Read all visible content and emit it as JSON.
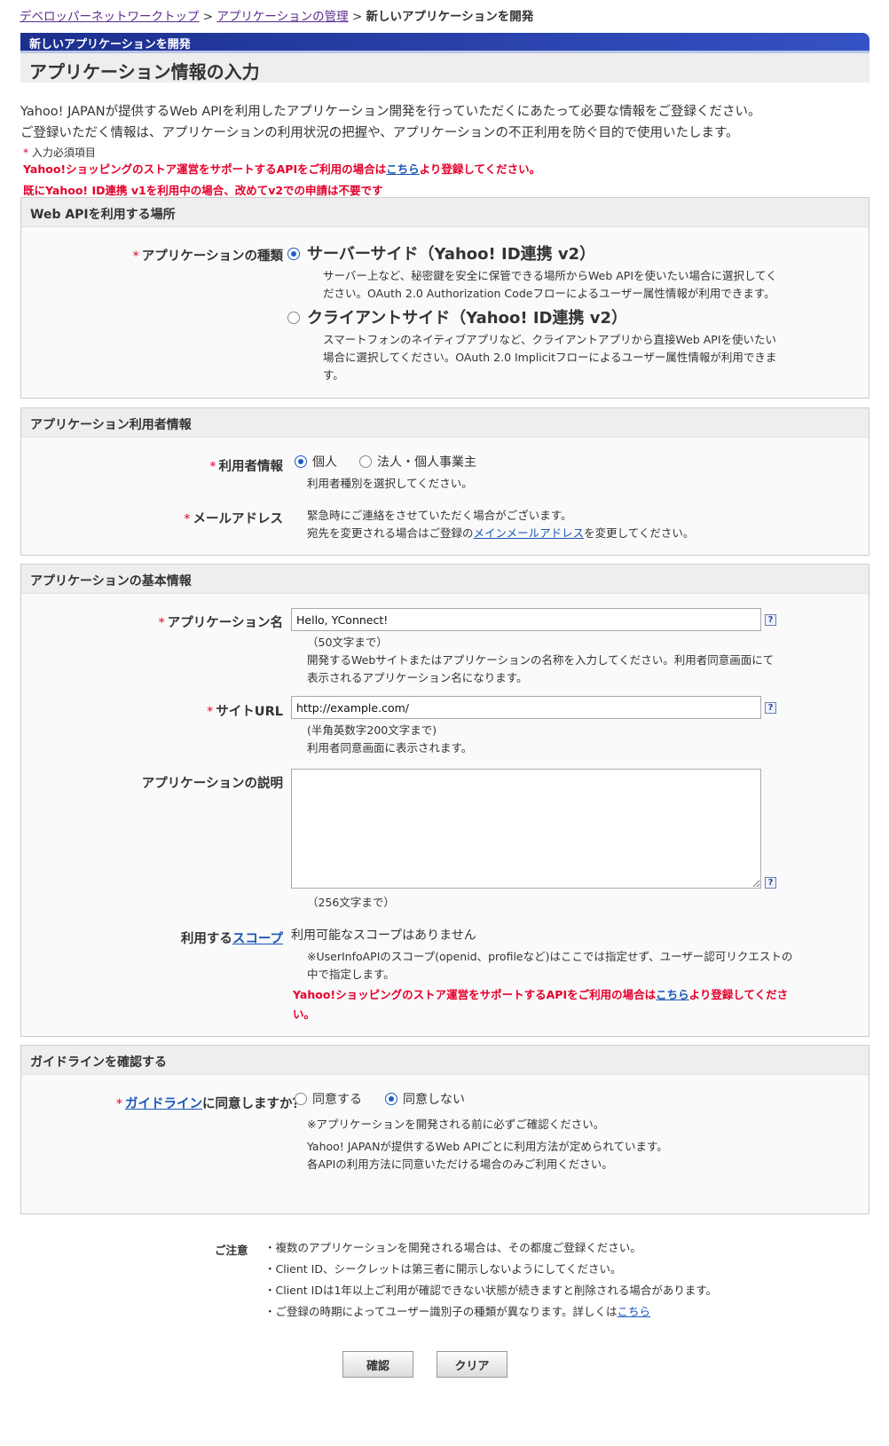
{
  "breadcrumb": {
    "items": [
      "デベロッパーネットワークトップ",
      "アプリケーションの管理"
    ],
    "separator": ">",
    "current": "新しいアプリケーションを開発"
  },
  "banner": {
    "subtitle": "新しいアプリケーションを開発",
    "title": "アプリケーション情報の入力"
  },
  "intro": {
    "line1": "Yahoo! JAPANが提供するWeb APIを利用したアプリケーション開発を行っていただくにあたって必要な情報をご登録ください。",
    "line2": "ご登録いただく情報は、アプリケーションの利用状況の把握や、アプリケーションの不正利用を防ぐ目的で使用いたします。",
    "required_note": "入力必須項目",
    "required_mark": "*",
    "shopping_pre": "Yahoo!ショッピングのストア運営をサポートするAPIをご利用の場合は",
    "shopping_link": "こちら",
    "shopping_post": "より登録してください。",
    "v1_note": "既にYahoo! ID連携 v1を利用中の場合、改めてv2での申請は不要です"
  },
  "section_webapi": {
    "header": "Web APIを利用する場所",
    "label": "アプリケーションの種類",
    "option_server": "サーバーサイド（Yahoo! ID連携 v2）",
    "option_server_desc1": "サーバー上など、秘密鍵を安全に保管できる場所からWeb APIを使いたい場合に選択してく",
    "option_server_desc2": "ださい。OAuth 2.0 Authorization Codeフローによるユーザー属性情報が利用できます。",
    "option_client": "クライアントサイド（Yahoo! ID連携 v2）",
    "option_client_desc1": "スマートフォンのネイティブアプリなど、クライアントアプリから直接Web APIを使いたい",
    "option_client_desc2": "場合に選択してください。OAuth 2.0 Implicitフローによるユーザー属性情報が利用できま",
    "option_client_desc3": "す。"
  },
  "section_user": {
    "header": "アプリケーション利用者情報",
    "user_label": "利用者情報",
    "opt_individual": "個人",
    "opt_corp": "法人・個人事業主",
    "user_hint": "利用者種別を選択してください。",
    "mail_label": "メールアドレス",
    "mail_text1": "緊急時にご連絡をさせていただく場合がございます。",
    "mail_text2_pre": "宛先を変更される場合はご登録の",
    "mail_link": "メインメールアドレス",
    "mail_text2_post": "を変更してください。"
  },
  "section_basic": {
    "header": "アプリケーションの基本情報",
    "name_label": "アプリケーション名",
    "name_value": "Hello, YConnect!",
    "name_limit": "（50文字まで）",
    "name_desc1": "開発するWebサイトまたはアプリケーションの名称を入力してください。利用者同意画面にて",
    "name_desc2": "表示されるアプリケーション名になります。",
    "url_label": "サイトURL",
    "url_value": "http://example.com/",
    "url_limit": "(半角英数字200文字まで)",
    "url_desc": "利用者同意画面に表示されます。",
    "desc_label": "アプリケーションの説明",
    "desc_value": "",
    "desc_limit": "（256文字まで）",
    "scope_label_pre": "利用する",
    "scope_label_link": "スコープ",
    "scope_none": "利用可能なスコープはありません",
    "scope_note1": "※UserInfoAPIのスコープ(openid、profileなど)はここでは指定せず、ユーザー認可リクエストの",
    "scope_note2": "中で指定します。",
    "scope_red1_pre": "Yahoo!ショッピングのストア運営をサポートするAPIをご利用の場合は",
    "scope_red1_link": "こちら",
    "scope_red1_post": "より登録してくださ",
    "scope_red2": "い。",
    "help": "?"
  },
  "section_guide": {
    "header": "ガイドラインを確認する",
    "label_link": "ガイドライン",
    "label_post": "に同意しますか？",
    "opt_agree": "同意する",
    "opt_disagree": "同意しない",
    "note1": "※アプリケーションを開発される前に必ずご確認ください。",
    "note2": "Yahoo! JAPANが提供するWeb APIごとに利用方法が定められています。",
    "note3": "各APIの利用方法に同意いただける場合のみご利用ください。"
  },
  "notes": {
    "label": "ご注意",
    "item1": "・複数のアプリケーションを開発される場合は、その都度ご登録ください。",
    "item2": "・Client ID、シークレットは第三者に開示しないようにしてください。",
    "item3": "・Client IDは1年以上ご利用が確認できない状態が続きますと削除される場合があります。",
    "item4_pre": "・ご登録の時期によってユーザー識別子の種類が異なります。詳しくは",
    "item4_link": "こちら"
  },
  "buttons": {
    "confirm": "確認",
    "clear": "クリア"
  },
  "colors": {
    "banner_gradient_start": "#1b2f8e",
    "banner_gradient_end": "#3552c4",
    "required_red": "#e4002b",
    "link_blue": "#1a56b8",
    "visited_purple": "#5a2d8c",
    "section_header_bg": "#eeeeee"
  }
}
